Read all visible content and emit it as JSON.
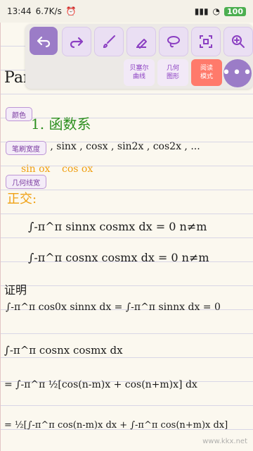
{
  "status": {
    "time": "13:44",
    "speed": "6.7K/s",
    "battery": "100"
  },
  "toolbar": {
    "undo_icon": "undo-arrow-icon",
    "redo_icon": "redo-arrow-icon",
    "brush_icon": "paintbrush-icon",
    "eraser_icon": "eraser-icon",
    "lasso_icon": "lasso-icon",
    "scan_icon": "scan-icon",
    "zoom_icon": "zoom-in-icon",
    "bezier_label": "贝塞尔\n曲线",
    "geometry_label": "几何\n图形",
    "read_mode_label": "阅读\n模式",
    "more_icon": "more-dots-icon",
    "accent_color": "#9b7cc7",
    "read_mode_color": "#ff7a6b"
  },
  "side_chips": {
    "color": "颜色",
    "brush_width": "笔刷宽度",
    "geometry_line_width": "几何线宽"
  },
  "notes": {
    "heading_line": "Part 1. 三角函数",
    "section_title": "1. 函数系",
    "series_line": "1 , sinx , cosx , sin2x , cos2x , ...",
    "annot_left": "sin ox",
    "annot_right": "cos ox",
    "orthogonal": "正交:",
    "eq1": "∫-π^π sinnx cosmx dx = 0    n≠m",
    "eq2": "∫-π^π cosnx cosmx dx = 0    n≠m",
    "proof": "证明",
    "eq3": "∫-π^π cos0x sinnx dx = ∫-π^π sinnx dx = 0",
    "eq4": "∫-π^π cosnx cosmx dx",
    "eq5": "= ∫-π^π ½[cos(n-m)x + cos(n+m)x] dx",
    "eq6": "= ½[∫-π^π cos(n-m)x dx + ∫-π^π cos(n+m)x dx]"
  },
  "watermark": "www.kkx.net"
}
